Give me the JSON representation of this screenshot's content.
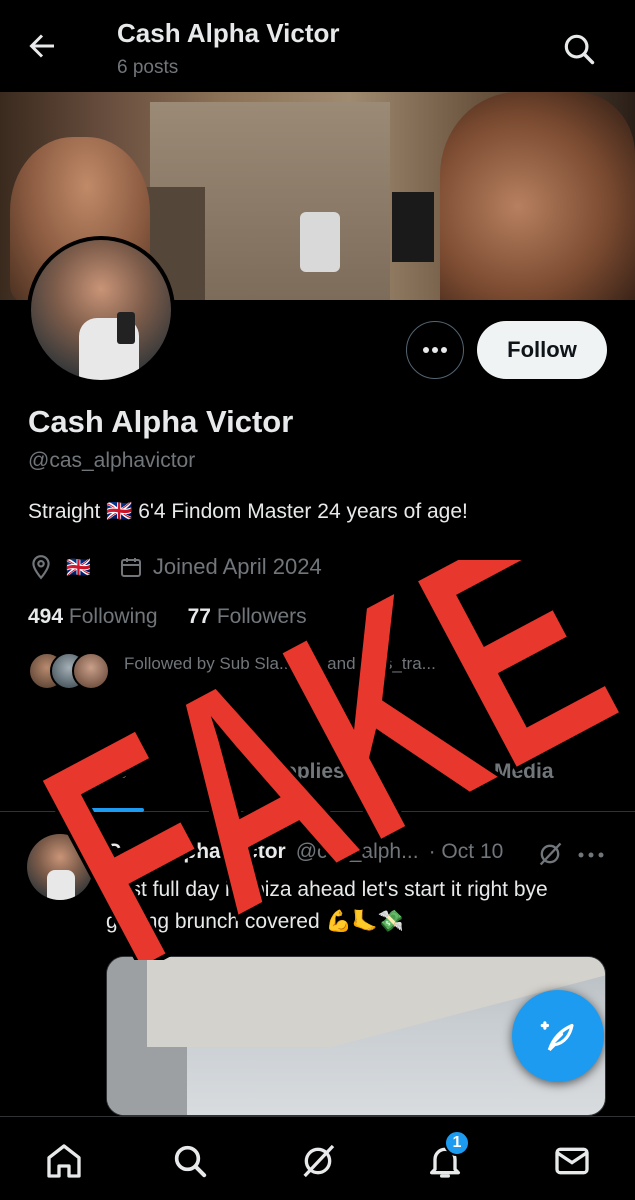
{
  "header": {
    "title": "Cash Alpha Victor",
    "subtitle": "6 posts"
  },
  "actions": {
    "follow_label": "Follow"
  },
  "profile": {
    "display_name": "Cash Alpha Victor",
    "handle": "@cas_alphavictor",
    "bio": "Straight 🇬🇧 6'4 Findom Master 24 years of age!",
    "location_flag": "🇬🇧",
    "joined": "Joined April 2024",
    "following_count": "494",
    "following_label": "Following",
    "followers_count": "77",
    "followers_label": "Followers",
    "followed_by": "Followed by Sub Sla... 2Z, and ...ns_tra..."
  },
  "tabs": [
    {
      "label": "Posts"
    },
    {
      "label": "Replies"
    },
    {
      "label": "Media"
    }
  ],
  "post": {
    "author": "Cash Alpha Victor",
    "handle": "@cas_alph...",
    "time": "· Oct 10",
    "text": "First full day in Ibiza ahead let's start it right bye getting brunch covered 💪🦶💸"
  },
  "notifications": {
    "badge_count": "1"
  },
  "overlay": {
    "stamp_text": "FAKE",
    "stamp_color": "#e8372c"
  },
  "colors": {
    "accent": "#1d9bf0",
    "background": "#000000",
    "muted_text": "#71767b"
  }
}
